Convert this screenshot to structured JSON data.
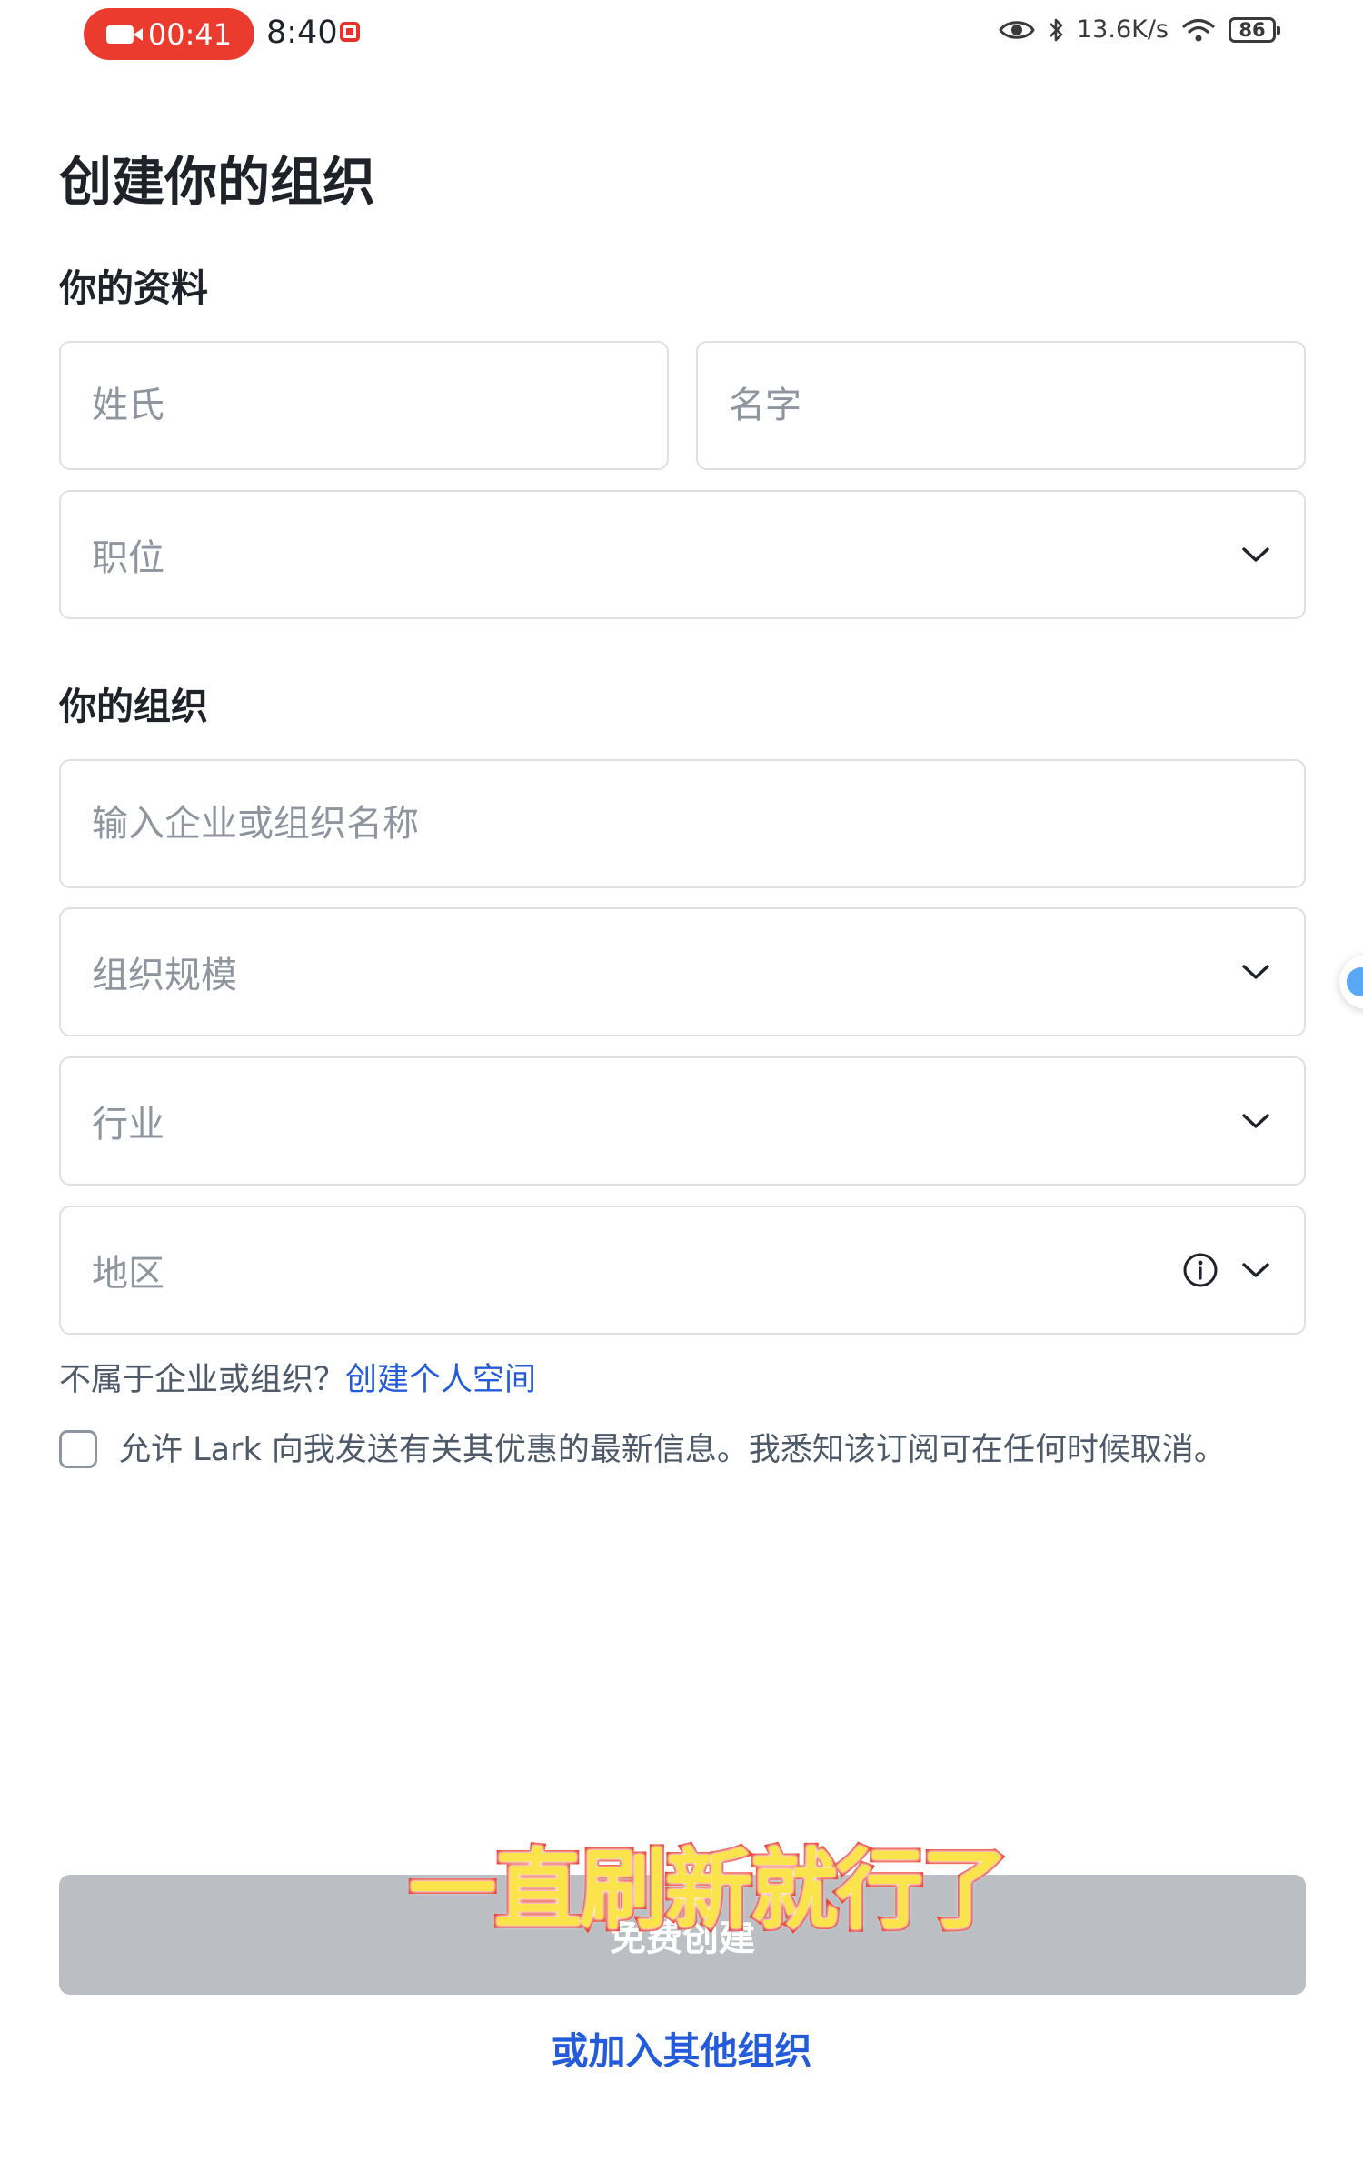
{
  "status_bar": {
    "recording_time": "00:41",
    "clock": "8:40",
    "network_speed": "13.6K/s",
    "battery_level": "86",
    "recording_color": "#ea3b2e"
  },
  "page": {
    "title": "创建你的组织"
  },
  "profile": {
    "section_label": "你的资料",
    "surname_placeholder": "姓氏",
    "given_name_placeholder": "名字",
    "position_placeholder": "职位"
  },
  "organization": {
    "section_label": "你的组织",
    "name_placeholder": "输入企业或组织名称",
    "size_placeholder": "组织规模",
    "industry_placeholder": "行业",
    "region_placeholder": "地区"
  },
  "personal_space": {
    "prompt": "不属于企业或组织？",
    "link_label": "创建个人空间"
  },
  "consent": {
    "text": "允许 Lark 向我发送有关其优惠的最新信息。我悉知该订阅可在任何时候取消。",
    "checked": false
  },
  "actions": {
    "submit_label": "免费创建",
    "join_other_label": "或加入其他组织",
    "accent_color": "#245bdb",
    "disabled_color": "#bbbfc4"
  },
  "overlay_caption": "一直刷新就行了",
  "icons": {
    "status": [
      "video-camera-icon",
      "eye-icon",
      "bluetooth-icon",
      "wifi-icon",
      "battery-icon"
    ],
    "fields": [
      "chevron-down-icon",
      "info-icon"
    ]
  }
}
